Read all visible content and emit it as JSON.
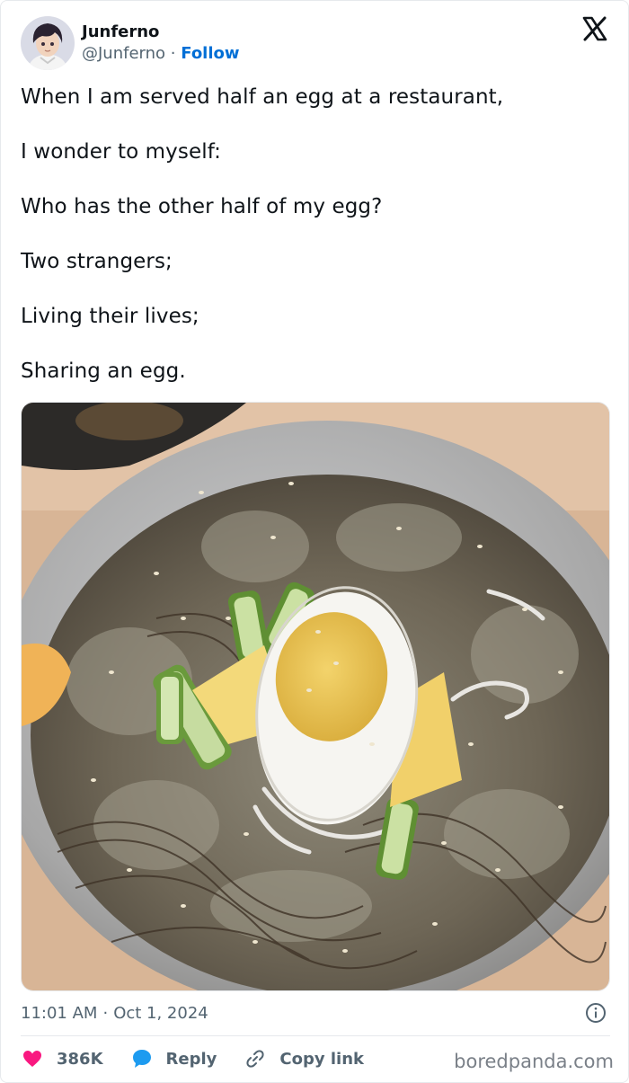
{
  "author": {
    "name": "Junferno",
    "handle": "@Junferno",
    "separator": "·",
    "follow_label": "Follow"
  },
  "icons": {
    "brand": "x-logo-icon",
    "like": "heart-icon",
    "reply": "speech-bubble-icon",
    "copy": "link-icon",
    "info": "info-icon"
  },
  "tweet": {
    "lines": [
      "When I am served half an egg at a restaurant,",
      "I wonder to myself:",
      "Who has the other half of my egg?",
      "Two strangers;",
      "Living their lives;",
      "Sharing an egg."
    ]
  },
  "meta": {
    "time": "11:01 AM",
    "separator": "·",
    "date": "Oct 1, 2024"
  },
  "actions": {
    "likes": "386K",
    "reply_label": "Reply",
    "copy_label": "Copy link"
  },
  "watermark": "boredpanda.com",
  "colors": {
    "heart": "#f91880",
    "reply": "#1d9bf0",
    "follow": "#006fd6",
    "muted": "#536471"
  }
}
